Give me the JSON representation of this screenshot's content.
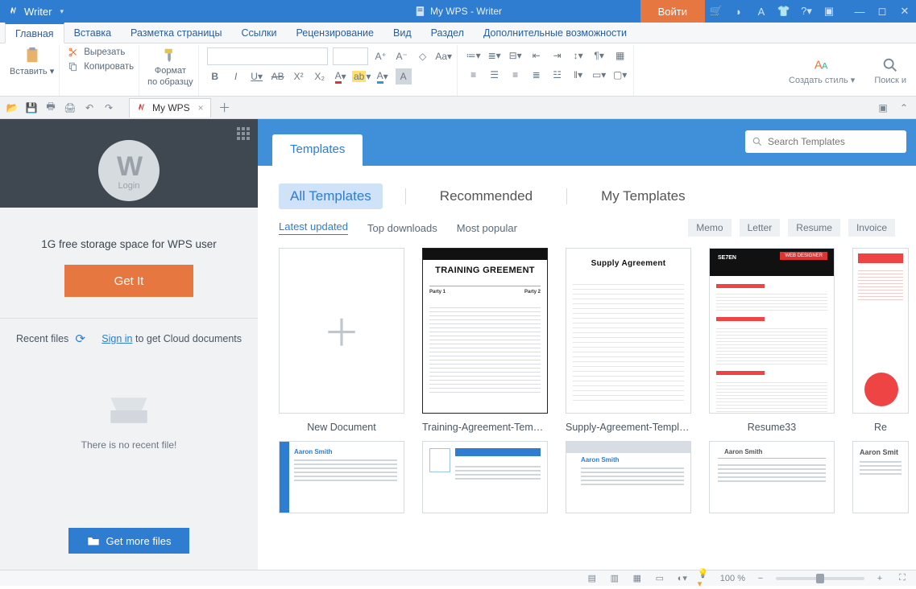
{
  "titlebar": {
    "app_name": "Writer",
    "doc_title": "My WPS - Writer",
    "login": "Войти"
  },
  "menu": {
    "items": [
      "Главная",
      "Вставка",
      "Разметка страницы",
      "Ссылки",
      "Рецензирование",
      "Вид",
      "Раздел",
      "Дополнительные возможности"
    ],
    "active_index": 0
  },
  "ribbon": {
    "paste": "Вставить",
    "cut": "Вырезать",
    "copy": "Копировать",
    "format_painter_line1": "Формат",
    "format_painter_line2": "по образцу",
    "create_style": "Создать стиль",
    "find": "Поиск и"
  },
  "doctab": {
    "label": "My WPS"
  },
  "sidebar": {
    "avatar_login": "Login",
    "storage_text": "1G free storage space for WPS user",
    "get_it": "Get It",
    "recent_files_label": "Recent files",
    "sign_in": "Sign in",
    "sign_in_tail": " to get Cloud documents",
    "no_recent": "There is no recent file!",
    "get_more": "Get more files"
  },
  "content": {
    "templates_tab": "Templates",
    "search_placeholder": "Search Templates",
    "filtersA": [
      "All Templates",
      "Recommended",
      "My Templates"
    ],
    "filtersB": [
      "Latest updated",
      "Top downloads",
      "Most popular"
    ],
    "chips": [
      "Memo",
      "Letter",
      "Resume",
      "Invoice"
    ],
    "row1": [
      {
        "caption": "New Document",
        "kind": "new"
      },
      {
        "caption": "Training-Agreement-Templ...",
        "kind": "training",
        "title": "TRAINING GREEMENT"
      },
      {
        "caption": "Supply-Agreement-Templa...",
        "kind": "supply",
        "title": "Supply Agreement"
      },
      {
        "caption": "Resume33",
        "kind": "resume_red",
        "name": "SE7EN"
      },
      {
        "caption": "Re",
        "kind": "resume_red2"
      }
    ],
    "row2_names": [
      "Aaron Smith",
      "",
      "Aaron Smith",
      "Aaron Smith",
      "Aaron Smit"
    ]
  },
  "status": {
    "zoom": "100 %"
  }
}
